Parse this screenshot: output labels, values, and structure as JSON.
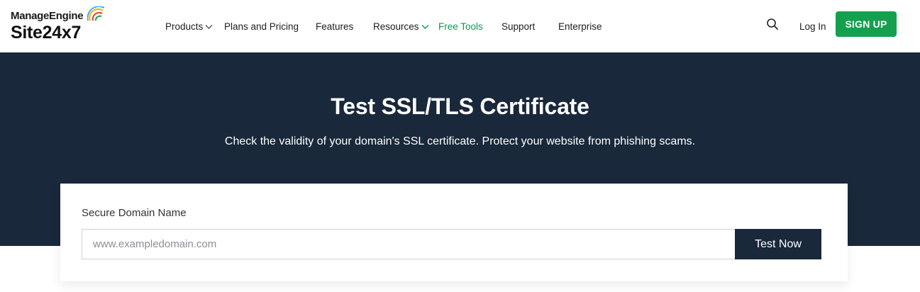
{
  "brand": {
    "company": "ManageEngine",
    "product": "Site24x7",
    "arc_colors": [
      "#f6b21a",
      "#e63a2a",
      "#1b9d4f",
      "#1ea0e6"
    ]
  },
  "nav": {
    "products": "Products",
    "plans": "Plans and Pricing",
    "features": "Features",
    "resources": "Resources",
    "free_tools": "Free Tools",
    "support": "Support",
    "enterprise": "Enterprise",
    "chevron_icon": "chevron-down-icon"
  },
  "header_actions": {
    "search_icon": "search-icon",
    "login": "Log In",
    "signup": "SIGN UP",
    "signup_color": "#14a04e"
  },
  "hero": {
    "title": "Test SSL/TLS Certificate",
    "subtitle": "Check the validity of your domain's SSL certificate. Protect your website from phishing scams.",
    "background": "#19283a"
  },
  "form": {
    "label": "Secure Domain Name",
    "placeholder": "www.exampledomain.com",
    "value": "",
    "submit": "Test Now"
  }
}
